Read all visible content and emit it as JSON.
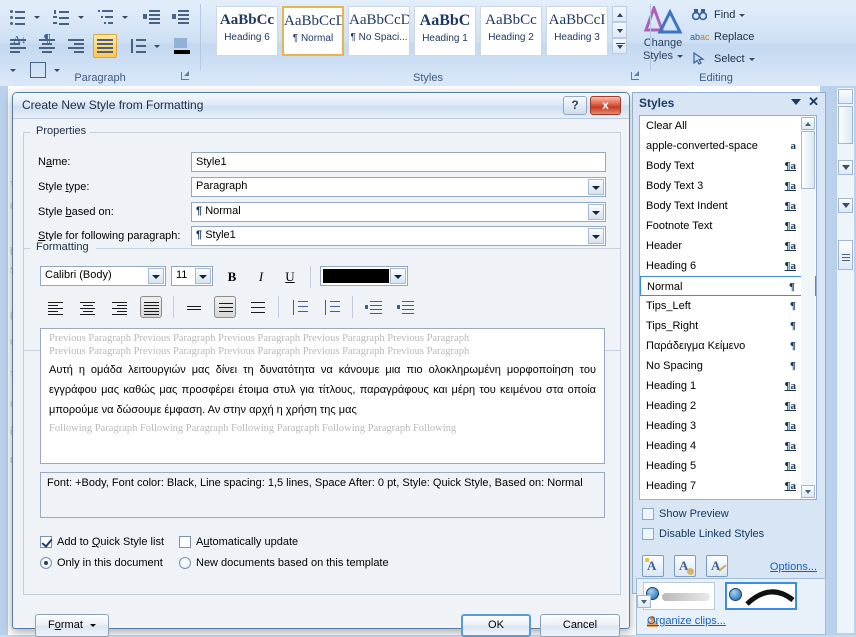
{
  "ribbon": {
    "paragraph": {
      "label": "Paragraph",
      "buttons": [
        {
          "name": "bullets",
          "tip": "Bullets"
        },
        {
          "name": "numbering",
          "tip": "Numbering"
        },
        {
          "name": "multilevel-list",
          "tip": "Multilevel List"
        },
        {
          "name": "decrease-indent",
          "tip": "Decrease Indent"
        },
        {
          "name": "increase-indent",
          "tip": "Increase Indent"
        },
        {
          "name": "sort",
          "tip": "Sort"
        },
        {
          "name": "show-formatting-marks",
          "tip": "Show/Hide ¶"
        },
        {
          "name": "align-left",
          "tip": "Align Text Left"
        },
        {
          "name": "align-center",
          "tip": "Center"
        },
        {
          "name": "align-right",
          "tip": "Align Text Right"
        },
        {
          "name": "justify",
          "tip": "Justify"
        },
        {
          "name": "line-spacing",
          "tip": "Line and Paragraph Spacing"
        },
        {
          "name": "shading",
          "tip": "Shading"
        },
        {
          "name": "borders",
          "tip": "Borders"
        }
      ]
    },
    "styles": {
      "label": "Styles",
      "gallery": [
        {
          "sample": "AaBbCc",
          "name": "Heading 6",
          "selected": false,
          "bold": true
        },
        {
          "sample": "AaBbCcDc",
          "name": "¶ Normal",
          "selected": true,
          "bold": false
        },
        {
          "sample": "AaBbCcDc",
          "name": "¶ No Spaci...",
          "selected": false,
          "bold": false
        },
        {
          "sample": "AaBbC",
          "name": "Heading 1",
          "selected": false,
          "bold": true
        },
        {
          "sample": "AaBbCc",
          "name": "Heading 2",
          "selected": false,
          "bold": false
        },
        {
          "sample": "AaBbCcI",
          "name": "Heading 3",
          "selected": false,
          "bold": false
        }
      ],
      "change_styles_label_line1": "Change",
      "change_styles_label_line2": "Styles"
    },
    "editing": {
      "label": "Editing",
      "items": [
        {
          "label": "Find",
          "icon": "binoculars-icon",
          "caret": true
        },
        {
          "label": "Replace",
          "icon": "replace-icon",
          "caret": false
        },
        {
          "label": "Select",
          "icon": "pointer-icon",
          "caret": true
        }
      ]
    }
  },
  "dialog": {
    "title": "Create New Style from Formatting",
    "help_label": "?",
    "close_label": "x",
    "properties": {
      "legend": "Properties",
      "fields": [
        {
          "label": "Name:",
          "value": "Style1",
          "type": "text"
        },
        {
          "label": "Style type:",
          "value": "Paragraph",
          "type": "combo"
        },
        {
          "label": "Style based on:",
          "value": "Normal",
          "type": "combo",
          "pilcrow": true
        },
        {
          "label": "Style for following paragraph:",
          "value": "Style1",
          "type": "combo",
          "pilcrow": true
        }
      ]
    },
    "formatting": {
      "legend": "Formatting",
      "font_name": "Calibri (Body)",
      "font_size": "11",
      "bold_label": "B",
      "italic_label": "I",
      "underline_label": "U",
      "font_color": "#000000",
      "toolbar": [
        {
          "name": "align-left-button",
          "selected": false
        },
        {
          "name": "align-center-button",
          "selected": false
        },
        {
          "name": "align-right-button",
          "selected": false
        },
        {
          "name": "justify-button",
          "selected": true
        },
        {
          "name": "line-spacing-single-button",
          "selected": false
        },
        {
          "name": "line-spacing-1-5-button",
          "selected": true
        },
        {
          "name": "line-spacing-double-button",
          "selected": false
        },
        {
          "name": "decrease-space-before-button",
          "selected": false
        },
        {
          "name": "increase-space-before-button",
          "selected": false
        },
        {
          "name": "decrease-indent-button",
          "selected": false
        },
        {
          "name": "increase-indent-button",
          "selected": false
        }
      ]
    },
    "preview": {
      "previous_line_1": "Previous Paragraph Previous Paragraph Previous Paragraph Previous Paragraph Previous Paragraph",
      "previous_line_2": "Previous Paragraph Previous Paragraph Previous Paragraph Previous Paragraph Previous Paragraph",
      "body": "Αυτή η ομάδα λειτουργιών μας δίνει τη δυνατότητα να κάνουμε μια πιο ολοκληρωμένη μορφοποίηση του εγγράφου μας καθώς μας προσφέρει έτοιμα στυλ για τίτλους, παραγράφους και μέρη του κειμένου στα οποία μπορούμε να δώσουμε έμφαση. Αν στην αρχή η χρήση της μας",
      "following_line": "Following Paragraph Following Paragraph Following Paragraph Following Paragraph Following"
    },
    "description": "Font: +Body, Font color: Black, Line spacing:  1,5 lines, Space After:  0 pt, Style: Quick Style, Based on: Normal",
    "options": [
      {
        "label": "Add to Quick Style list",
        "type": "checkbox",
        "checked": true
      },
      {
        "label": "Automatically update",
        "type": "checkbox",
        "checked": false
      },
      {
        "label": "Only in this document",
        "type": "radio",
        "checked": true
      },
      {
        "label": "New documents based on this template",
        "type": "radio",
        "checked": false
      }
    ],
    "buttons": {
      "format": "Format",
      "ok": "OK",
      "cancel": "Cancel"
    }
  },
  "styles_pane": {
    "title": "Styles",
    "items": [
      {
        "label": "Clear All",
        "mark": "",
        "selected": false
      },
      {
        "label": "apple-converted-space",
        "mark": "a",
        "selected": false
      },
      {
        "label": "Body Text",
        "mark": "¶a",
        "selected": false
      },
      {
        "label": "Body Text 3",
        "mark": "¶a",
        "selected": false
      },
      {
        "label": "Body Text Indent",
        "mark": "¶a",
        "selected": false
      },
      {
        "label": "Footnote Text",
        "mark": "¶a",
        "selected": false
      },
      {
        "label": "Header",
        "mark": "¶a",
        "selected": false
      },
      {
        "label": "Heading 6",
        "mark": "¶a",
        "selected": false
      },
      {
        "label": "Normal",
        "mark": "¶",
        "selected": true
      },
      {
        "label": "Tips_Left",
        "mark": "¶",
        "selected": false
      },
      {
        "label": "Tips_Right",
        "mark": "¶",
        "selected": false
      },
      {
        "label": "Παράδειγμα Κείμενο",
        "mark": "¶",
        "selected": false
      },
      {
        "label": "No Spacing",
        "mark": "¶",
        "selected": false
      },
      {
        "label": "Heading 1",
        "mark": "¶a",
        "selected": false
      },
      {
        "label": "Heading 2",
        "mark": "¶a",
        "selected": false
      },
      {
        "label": "Heading 3",
        "mark": "¶a",
        "selected": false
      },
      {
        "label": "Heading 4",
        "mark": "¶a",
        "selected": false
      },
      {
        "label": "Heading 5",
        "mark": "¶a",
        "selected": false
      },
      {
        "label": "Heading 7",
        "mark": "¶a",
        "selected": false
      }
    ],
    "checkboxes": [
      {
        "label": "Show Preview",
        "checked": false
      },
      {
        "label": "Disable Linked Styles",
        "checked": false
      }
    ],
    "footer_buttons": [
      {
        "name": "new-style-button",
        "glyph": "A"
      },
      {
        "name": "style-inspector-button",
        "glyph": "A"
      },
      {
        "name": "manage-styles-button",
        "glyph": "A"
      }
    ],
    "options_link": "Options..."
  },
  "clipart_pane": {
    "organize_link": "Organize clips...",
    "thumbnails": [
      {
        "name": "clip-thumbnail-1",
        "selected": false
      },
      {
        "name": "clip-thumbnail-2",
        "selected": true
      }
    ]
  },
  "document_ghost": {
    "lines": [
      "τα",
      "α",
      "b",
      "s",
      "ρ",
      "ον",
      "τα",
      "ο",
      "ί",
      "ευ"
    ]
  }
}
